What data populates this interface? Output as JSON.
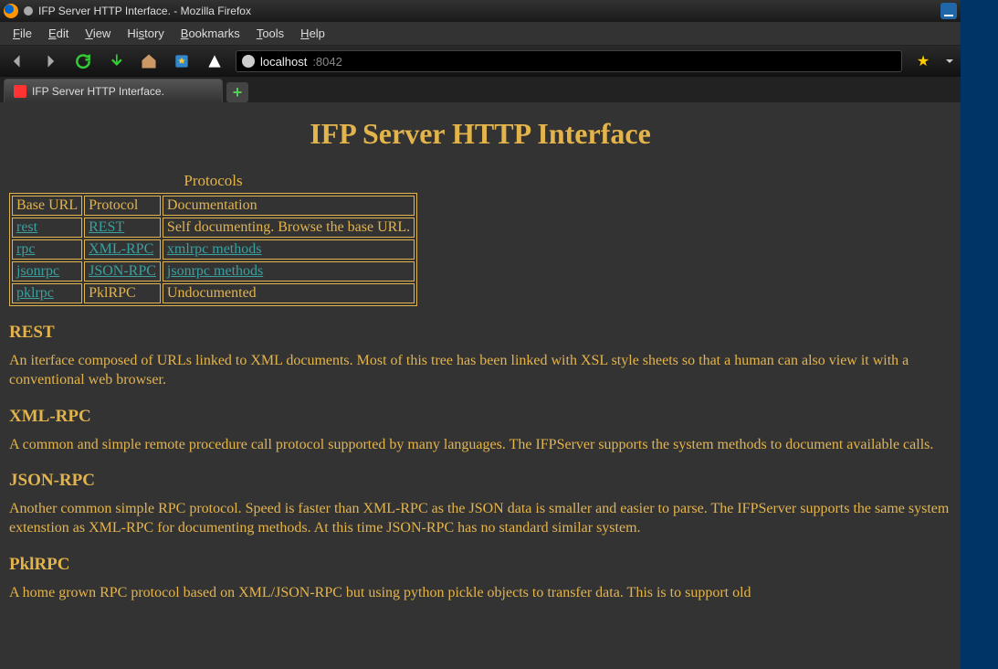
{
  "window": {
    "title": "IFP Server HTTP Interface. - Mozilla Firefox"
  },
  "menubar": {
    "file": "File",
    "edit": "Edit",
    "view": "View",
    "history": "History",
    "bookmarks": "Bookmarks",
    "tools": "Tools",
    "help": "Help"
  },
  "urlbar": {
    "host": "localhost",
    "port": ":8042"
  },
  "tabs": {
    "active": "IFP Server HTTP Interface."
  },
  "page": {
    "title": "IFP Server HTTP Interface",
    "table": {
      "caption": "Protocols",
      "headers": {
        "base": "Base URL",
        "proto": "Protocol",
        "doc": "Documentation"
      },
      "rows": [
        {
          "base": "rest",
          "proto": "REST",
          "doc": "Self documenting. Browse the base URL.",
          "doc_link": false
        },
        {
          "base": "rpc",
          "proto": "XML-RPC",
          "doc": "xmlrpc methods",
          "doc_link": true
        },
        {
          "base": "jsonrpc",
          "proto": "JSON-RPC",
          "doc": "jsonrpc methods",
          "doc_link": true
        },
        {
          "base": "pklrpc",
          "proto": "PklRPC",
          "doc": "Undocumented",
          "doc_link": false
        }
      ]
    },
    "sections": {
      "rest": {
        "heading": "REST",
        "body": "An iterface composed of URLs linked to XML documents. Most of this tree has been linked with XSL style sheets so that a human can also view it with a conventional web browser."
      },
      "xmlrpc": {
        "heading": "XML-RPC",
        "body": "A common and simple remote procedure call protocol supported by many languages. The IFPServer supports the system methods to document available calls."
      },
      "jsonrpc": {
        "heading": "JSON-RPC",
        "body": "Another common simple RPC protocol. Speed is faster than XML-RPC as the JSON data is smaller and easier to parse. The IFPServer supports the same system extenstion as XML-RPC for documenting methods. At this time JSON-RPC has no standard similar system."
      },
      "pklrpc": {
        "heading": "PklRPC",
        "body": "A home grown RPC protocol based on XML/JSON-RPC but using python pickle objects to transfer data. This is to support old"
      }
    }
  }
}
